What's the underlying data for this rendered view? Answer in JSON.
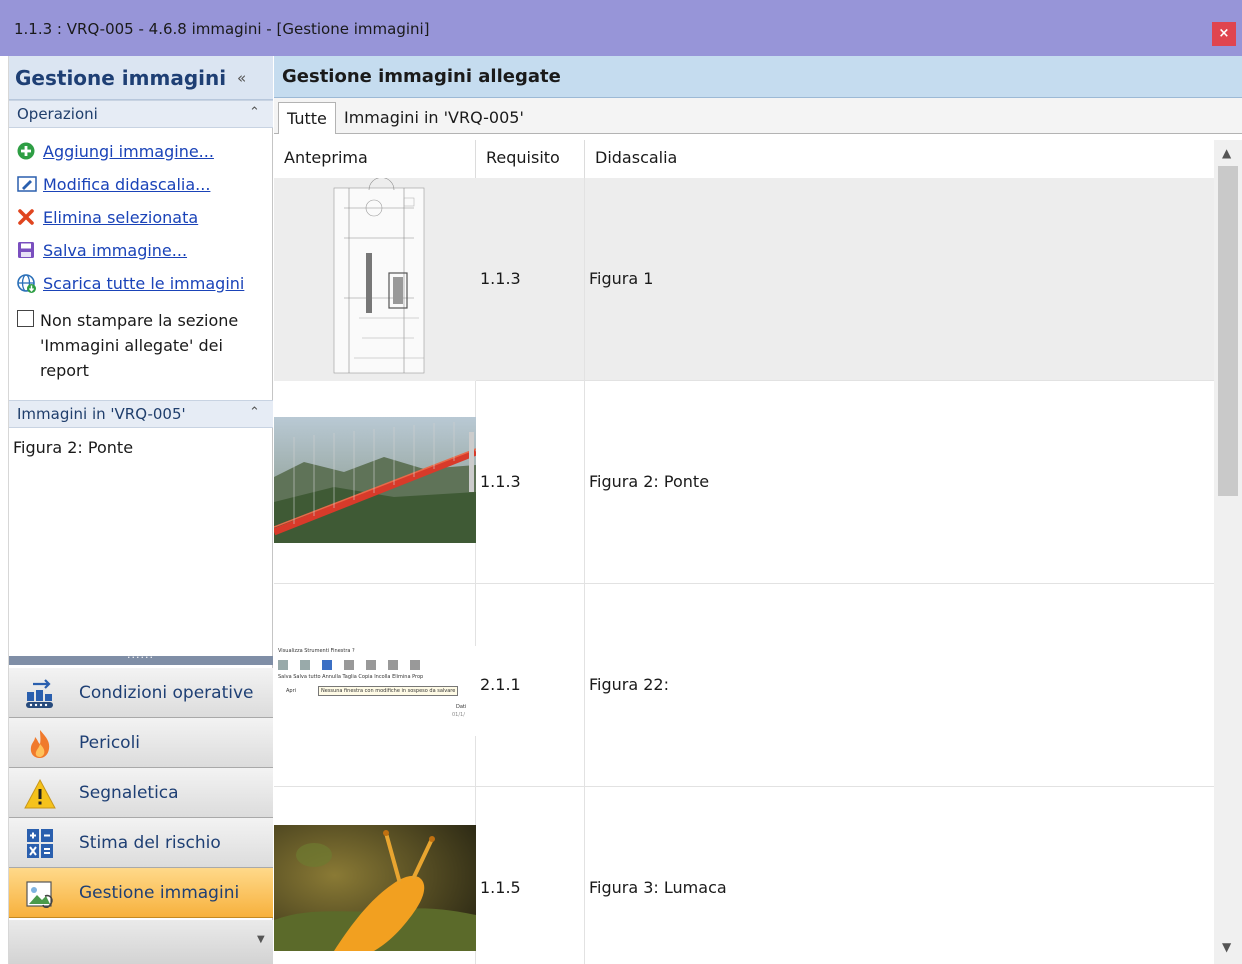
{
  "window": {
    "title": "1.1.3 : VRQ-005 - 4.6.8 immagini - [Gestione immagini]",
    "close_label": "×"
  },
  "sidebar": {
    "title": "Gestione immagini",
    "collapse_glyph": "«",
    "operations": {
      "header": "Operazioni",
      "items": [
        {
          "label": "Aggiungi immagine...",
          "icon": "add-icon",
          "color": "#2e9e44"
        },
        {
          "label": "Modifica didascalia...",
          "icon": "edit-caption-icon",
          "color": "#2a5fae"
        },
        {
          "label": "Elimina selezionata",
          "icon": "delete-icon",
          "color": "#e0451f"
        },
        {
          "label": "Salva immagine...",
          "icon": "save-icon",
          "color": "#7a4fbf"
        },
        {
          "label": "Scarica tutte le immagini",
          "icon": "download-globe-icon",
          "color": "#2a6fb8"
        }
      ],
      "checkbox": {
        "label": "Non stampare la sezione 'Immagini allegate' dei report",
        "checked": false
      }
    },
    "images_section": {
      "header": "Immagini in 'VRQ-005'",
      "items": [
        "Figura 2: Ponte"
      ]
    },
    "nav": [
      {
        "label": "Condizioni operative",
        "icon": "operating-conditions-icon",
        "active": false
      },
      {
        "label": "Pericoli",
        "icon": "fire-icon",
        "active": false
      },
      {
        "label": "Segnaletica",
        "icon": "warning-sign-icon",
        "active": false
      },
      {
        "label": "Stima del rischio",
        "icon": "calculator-icon",
        "active": false
      },
      {
        "label": "Gestione immagini",
        "icon": "image-manager-icon",
        "active": true
      }
    ]
  },
  "main": {
    "title": "Gestione immagini allegate",
    "tabs": [
      {
        "label": "Tutte",
        "active": true
      },
      {
        "label": "Immagini in 'VRQ-005'",
        "active": false
      }
    ],
    "columns": [
      "Anteprima",
      "Requisito",
      "Didascalia"
    ],
    "rows": [
      {
        "requisito": "1.1.3",
        "didascalia": "Figura 1",
        "thumb": "technical-drawing",
        "selected": true
      },
      {
        "requisito": "1.1.3",
        "didascalia": "Figura 2: Ponte",
        "thumb": "bridge-photo",
        "selected": false
      },
      {
        "requisito": "2.1.1",
        "didascalia": "Figura 22:",
        "thumb": "toolbar-screenshot",
        "selected": false
      },
      {
        "requisito": "1.1.5",
        "didascalia": "Figura 3: Lumaca",
        "thumb": "snail-photo",
        "selected": false
      }
    ],
    "thumb_texts": {
      "menu": "Visualizza   Strumenti   Finestra   ?",
      "buttons": "Salva  Salva tutto  Annulla  Taglia  Copia  Incolla  Elimina  Prop",
      "tooltip": "Nessuna finestra con modifiche in sospeso da salvare",
      "apri": "Apri",
      "dati": "Dati",
      "date": "01/1/"
    }
  },
  "colors": {
    "titlebar": "#9795d8",
    "accent_active": "#f7b13d",
    "link": "#1a43b8"
  }
}
